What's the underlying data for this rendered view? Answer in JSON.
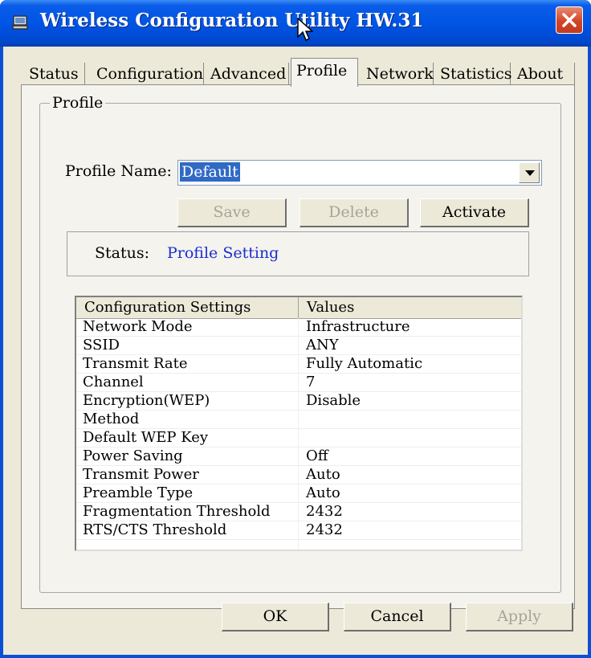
{
  "window": {
    "title": "Wireless Configuration Utility HW.31"
  },
  "tabs": [
    "Status",
    "Configuration",
    "Advanced",
    "Profile",
    "Network",
    "Statistics",
    "About"
  ],
  "active_tab": "Profile",
  "profile_group": {
    "legend": "Profile",
    "name_label": "Profile Name:",
    "name_value": "Default",
    "buttons": {
      "save": "Save",
      "delete": "Delete",
      "activate": "Activate"
    },
    "status_label": "Status:",
    "status_value": "Profile Setting"
  },
  "table": {
    "headers": [
      "Configuration Settings",
      "Values"
    ],
    "rows": [
      [
        "Network Mode",
        "Infrastructure"
      ],
      [
        "SSID",
        "ANY"
      ],
      [
        "Transmit Rate",
        "Fully Automatic"
      ],
      [
        "Channel",
        "7"
      ],
      [
        "Encryption(WEP)",
        "Disable"
      ],
      [
        "Method",
        ""
      ],
      [
        "Default WEP Key",
        ""
      ],
      [
        "Power Saving",
        "Off"
      ],
      [
        "Transmit Power",
        "Auto"
      ],
      [
        "Preamble Type",
        "Auto"
      ],
      [
        "Fragmentation Threshold",
        "2432"
      ],
      [
        "RTS/CTS Threshold",
        "2432"
      ]
    ]
  },
  "footer": {
    "ok": "OK",
    "cancel": "Cancel",
    "apply": "Apply"
  },
  "colors": {
    "titlebar": "#0055e5",
    "status_value": "#1a2fd0",
    "selection": "#316ac5",
    "close": "#d2452a"
  }
}
